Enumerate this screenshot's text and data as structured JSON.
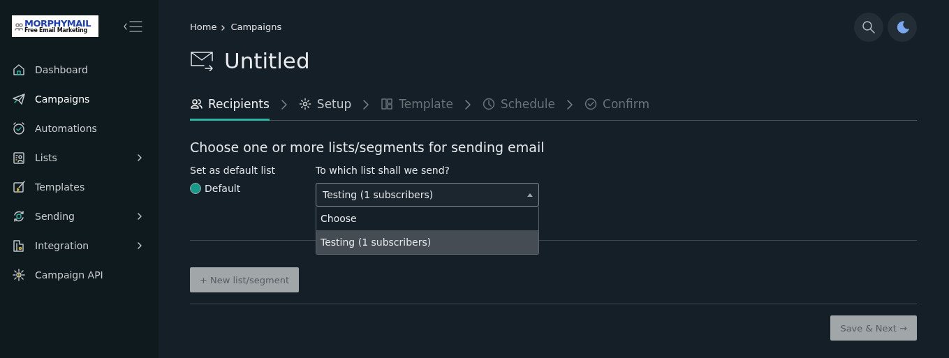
{
  "logo": {
    "name": "MORPHYMAIL",
    "tagline": "Free Email Marketing"
  },
  "sidebar": {
    "items": [
      {
        "label": "Dashboard",
        "selected": false,
        "expandable": false
      },
      {
        "label": "Campaigns",
        "selected": true,
        "expandable": false
      },
      {
        "label": "Automations",
        "selected": false,
        "expandable": false
      },
      {
        "label": "Lists",
        "selected": false,
        "expandable": true
      },
      {
        "label": "Templates",
        "selected": false,
        "expandable": false
      },
      {
        "label": "Sending",
        "selected": false,
        "expandable": true
      },
      {
        "label": "Integration",
        "selected": false,
        "expandable": true
      },
      {
        "label": "Campaign API",
        "selected": false,
        "expandable": false
      }
    ]
  },
  "breadcrumb": [
    "Home",
    "Campaigns"
  ],
  "title": "Untitled",
  "steps": [
    {
      "label": "Recipients",
      "selected": true,
      "disabled": false
    },
    {
      "label": "Setup",
      "selected": false,
      "disabled": false
    },
    {
      "label": "Template",
      "selected": false,
      "disabled": true
    },
    {
      "label": "Schedule",
      "selected": false,
      "disabled": true
    },
    {
      "label": "Confirm",
      "selected": false,
      "disabled": true
    }
  ],
  "heading": "Choose one or more lists/segments for sending email",
  "default_label": "Set as default list",
  "default_radio": {
    "label": "Default",
    "checked": true
  },
  "list_label": "To which list shall we send?",
  "list_select": {
    "value": "Testing (1 subscribers)",
    "expanded": true,
    "options": [
      {
        "label": "Choose",
        "selected": false
      },
      {
        "label": "Testing (1 subscribers)",
        "selected": true
      }
    ]
  },
  "new_button": {
    "label": "+ New list/segment",
    "disabled": true
  },
  "next_button": {
    "label": "Save & Next →",
    "disabled": true
  }
}
